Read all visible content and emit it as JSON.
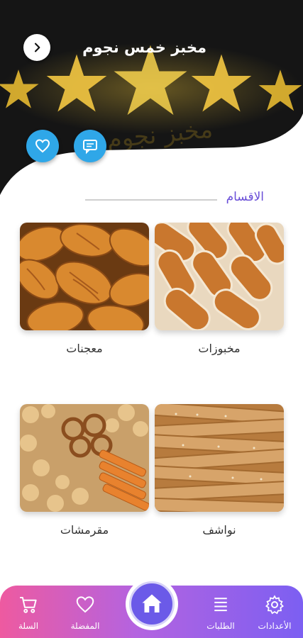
{
  "header": {
    "title": "مخبز خمس نجوم",
    "watermark": "مخبز نجوم"
  },
  "actions": {
    "favorite_icon": "heart-icon",
    "chat_icon": "chat-icon",
    "back_icon": "chevron-icon"
  },
  "section": {
    "title": "الاقسام"
  },
  "categories": [
    {
      "label": "مخبوزات"
    },
    {
      "label": "معجنات"
    },
    {
      "label": "نواشف"
    },
    {
      "label": "مقرمشات"
    }
  ],
  "bottom_nav": {
    "settings": "الأعدادات",
    "orders": "الطلبات",
    "favorites": "المفضلة",
    "cart": "السلة"
  },
  "colors": {
    "accent": "#6a4fd8",
    "fab": "#2fa7e8",
    "nav_start": "#ee5aa0",
    "nav_end": "#7c5ff2"
  }
}
